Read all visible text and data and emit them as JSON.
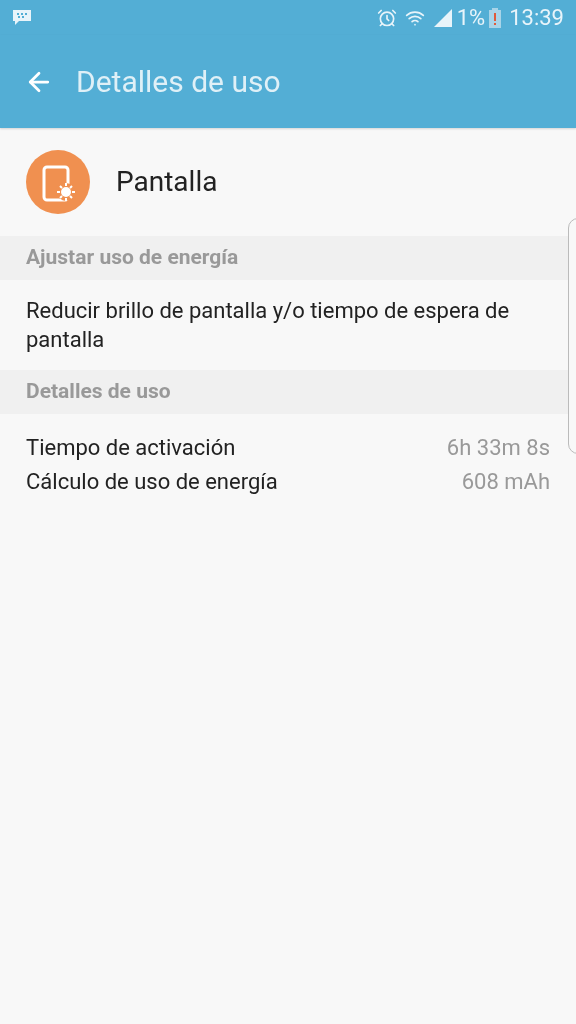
{
  "status_bar": {
    "battery": "1%",
    "time": "13:39"
  },
  "app_bar": {
    "title": "Detalles de uso"
  },
  "app": {
    "name": "Pantalla"
  },
  "sections": [
    {
      "title": "Ajustar uso de energía",
      "kind": "link",
      "text": "Reducir brillo de pantalla y/o tiempo de espera de pantalla"
    },
    {
      "title": "Detalles de uso",
      "kind": "details",
      "rows": [
        {
          "label": "Tiempo de activación",
          "value": "6h 33m 8s"
        },
        {
          "label": "Cálculo de uso de energía",
          "value": "608 mAh"
        }
      ]
    }
  ]
}
